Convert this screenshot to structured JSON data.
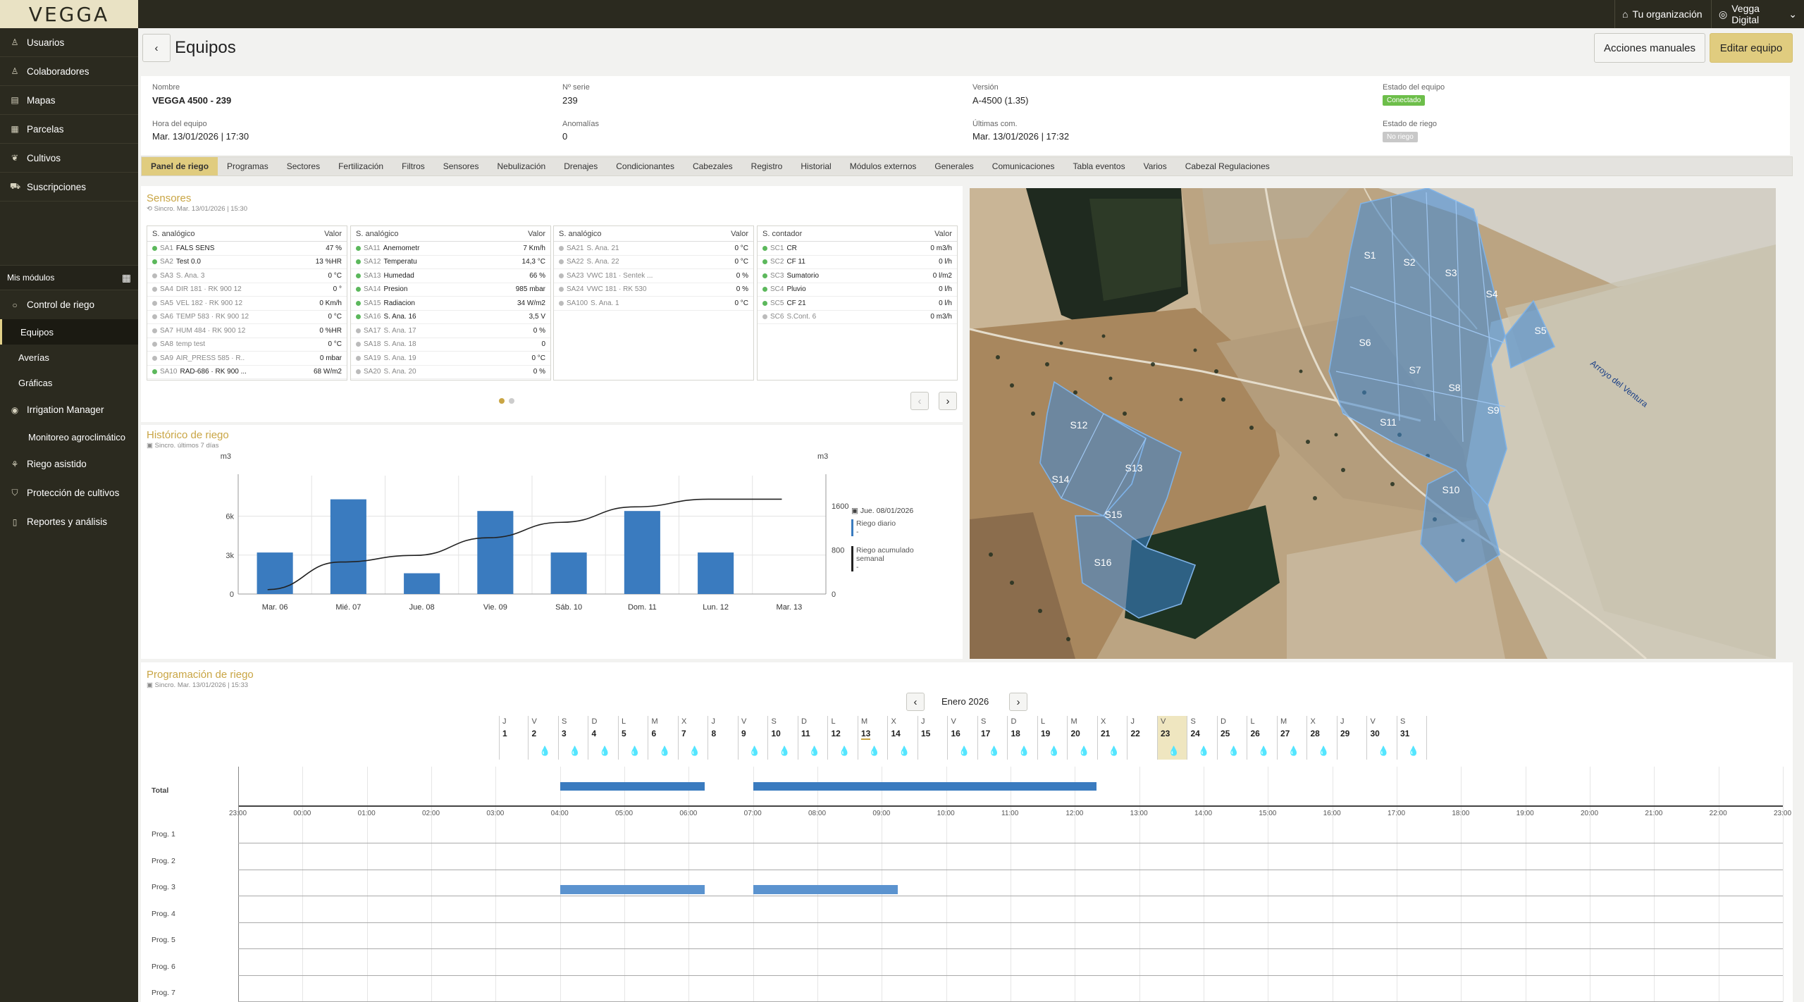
{
  "app": {
    "logo": "VEGGA"
  },
  "topbar": {
    "org_label": "Tu organización",
    "user_label": "Vegga Digital"
  },
  "sidebar": {
    "items": [
      {
        "label": "Usuarios",
        "icon": "user-icon"
      },
      {
        "label": "Colaboradores",
        "icon": "users-icon"
      },
      {
        "label": "Mapas",
        "icon": "map-icon"
      },
      {
        "label": "Parcelas",
        "icon": "plot-icon"
      },
      {
        "label": "Cultivos",
        "icon": "leaf-icon"
      },
      {
        "label": "Suscripciones",
        "icon": "cart-icon"
      }
    ],
    "modules_label": "Mis módulos",
    "modules": [
      {
        "label": "Control de riego"
      },
      {
        "label": "Equipos"
      },
      {
        "label": "Averías"
      },
      {
        "label": "Gráficas"
      },
      {
        "label": "Irrigation Manager"
      },
      {
        "label": "Monitoreo agroclimático"
      },
      {
        "label": "Riego asistido"
      },
      {
        "label": "Protección de cultivos"
      },
      {
        "label": "Reportes y análisis"
      }
    ]
  },
  "header": {
    "title": "Equipos",
    "manual_actions": "Acciones manuales",
    "edit": "Editar equipo"
  },
  "info": {
    "nombre_label": "Nombre",
    "nombre": "VEGGA 4500 - 239",
    "serie_label": "Nº serie",
    "serie": "239",
    "version_label": "Versión",
    "version": "A-4500 (1.35)",
    "estado_label": "Estado del equipo",
    "estado": "Conectado",
    "hora_label": "Hora del equipo",
    "hora": "Mar. 13/01/2026 | 17:30",
    "anomalias_label": "Anomalías",
    "anomalias": "0",
    "ultimas_label": "Últimas com.",
    "ultimas": "Mar. 13/01/2026 | 17:32",
    "riego_label": "Estado de riego",
    "riego": "No riego"
  },
  "tabs": [
    "Panel de riego",
    "Programas",
    "Sectores",
    "Fertilización",
    "Filtros",
    "Sensores",
    "Nebulización",
    "Drenajes",
    "Condicionantes",
    "Cabezales",
    "Registro",
    "Historial",
    "Módulos externos",
    "Generales",
    "Comunicaciones",
    "Tabla eventos",
    "Varios",
    "Cabezal Regulaciones"
  ],
  "sensores": {
    "title": "Sensores",
    "sync": "Sincro. Mar. 13/01/2026 | 15:30",
    "tables": [
      {
        "header": "S. analógico",
        "value_header": "Valor",
        "rows": [
          {
            "code": "SA1",
            "name": "FALS SENS",
            "value": "47 %",
            "on": true
          },
          {
            "code": "SA2",
            "name": "Test 0.0",
            "value": "13 %HR",
            "on": true
          },
          {
            "code": "SA3",
            "name": "S. Ana. 3",
            "value": "0 °C",
            "on": false
          },
          {
            "code": "SA4",
            "name": "DIR 181 · RK 900 12",
            "value": "0 °",
            "on": false
          },
          {
            "code": "SA5",
            "name": "VEL 182 · RK 900 12",
            "value": "0 Km/h",
            "on": false
          },
          {
            "code": "SA6",
            "name": "TEMP 583 · RK 900 12",
            "value": "0 °C",
            "on": false
          },
          {
            "code": "SA7",
            "name": "HUM 484 · RK 900 12",
            "value": "0 %HR",
            "on": false
          },
          {
            "code": "SA8",
            "name": "temp test",
            "value": "0 °C",
            "on": false
          },
          {
            "code": "SA9",
            "name": "AIR_PRESS 585 · R..",
            "value": "0 mbar",
            "on": false
          },
          {
            "code": "SA10",
            "name": "RAD-686 · RK 900 ...",
            "value": "68 W/m2",
            "on": true
          }
        ]
      },
      {
        "header": "S. analógico",
        "value_header": "Valor",
        "rows": [
          {
            "code": "SA11",
            "name": "Anemometr",
            "value": "7 Km/h",
            "on": true
          },
          {
            "code": "SA12",
            "name": "Temperatu",
            "value": "14,3 °C",
            "on": true
          },
          {
            "code": "SA13",
            "name": "Humedad",
            "value": "66 %",
            "on": true
          },
          {
            "code": "SA14",
            "name": "Presion",
            "value": "985 mbar",
            "on": true
          },
          {
            "code": "SA15",
            "name": "Radiacion",
            "value": "34 W/m2",
            "on": true
          },
          {
            "code": "SA16",
            "name": "S. Ana. 16",
            "value": "3,5 V",
            "on": true
          },
          {
            "code": "SA17",
            "name": "S. Ana. 17",
            "value": "0 %",
            "on": false
          },
          {
            "code": "SA18",
            "name": "S. Ana. 18",
            "value": "0",
            "on": false
          },
          {
            "code": "SA19",
            "name": "S. Ana. 19",
            "value": "0 °C",
            "on": false
          },
          {
            "code": "SA20",
            "name": "S. Ana. 20",
            "value": "0 %",
            "on": false
          }
        ]
      },
      {
        "header": "S. analógico",
        "value_header": "Valor",
        "rows": [
          {
            "code": "SA21",
            "name": "S. Ana. 21",
            "value": "0 °C",
            "on": false
          },
          {
            "code": "SA22",
            "name": "S. Ana. 22",
            "value": "0 °C",
            "on": false
          },
          {
            "code": "SA23",
            "name": "VWC 181 · Sentek ...",
            "value": "0 %",
            "on": false
          },
          {
            "code": "SA24",
            "name": "VWC 181 · RK 530",
            "value": "0 %",
            "on": false
          },
          {
            "code": "SA100",
            "name": "S. Ana. 1",
            "value": "0 °C",
            "on": false
          }
        ]
      },
      {
        "header": "S. contador",
        "value_header": "Valor",
        "rows": [
          {
            "code": "SC1",
            "name": "CR",
            "value": "0 m3/h",
            "on": true
          },
          {
            "code": "SC2",
            "name": "CF 11",
            "value": "0 l/h",
            "on": true
          },
          {
            "code": "SC3",
            "name": "Sumatorio",
            "value": "0 l/m2",
            "on": true
          },
          {
            "code": "SC4",
            "name": "Pluvio",
            "value": "0 l/h",
            "on": true
          },
          {
            "code": "SC5",
            "name": "CF 21",
            "value": "0 l/h",
            "on": true
          },
          {
            "code": "SC6",
            "name": "S.Cont. 6",
            "value": "0 m3/h",
            "on": false
          }
        ]
      }
    ]
  },
  "historico": {
    "title": "Histórico de riego",
    "sync": "Sincro. últimos 7 días",
    "legend_date": "Jue. 08/01/2026",
    "legend_daily": "Riego diario",
    "legend_daily_value": "-",
    "legend_weekly": "Riego acumulado semanal",
    "legend_weekly_value": "-"
  },
  "chart_data": {
    "type": "bar",
    "categories": [
      "Mar. 06",
      "Mié. 07",
      "Jue. 08",
      "Vie. 09",
      "Sáb. 10",
      "Dom. 11",
      "Lun. 12",
      "Mar. 13"
    ],
    "series": [
      {
        "name": "Riego diario",
        "type": "bar",
        "axis": "left",
        "values": [
          3200,
          7300,
          1600,
          6400,
          3200,
          6400,
          3200,
          0
        ]
      },
      {
        "name": "Riego acumulado semanal",
        "type": "line",
        "axis": "right",
        "values": [
          80,
          580,
          700,
          1020,
          1300,
          1580,
          1720,
          1720
        ]
      }
    ],
    "ylabel": "m3",
    "y2label": "m3",
    "ylim": [
      0,
      8800
    ],
    "yticks": [
      0,
      3000,
      6000
    ],
    "ytick_labels": [
      "0",
      "3k",
      "6k"
    ],
    "y2lim": [
      0,
      2070
    ],
    "y2ticks": [
      0,
      800,
      1600
    ],
    "grid": true
  },
  "map": {
    "sectors": [
      "S1",
      "S2",
      "S3",
      "S4",
      "S5",
      "S6",
      "S7",
      "S8",
      "S9",
      "S10",
      "S11",
      "S12",
      "S13",
      "S14",
      "S15",
      "S16"
    ],
    "road_label": "Arroyo del Ventura"
  },
  "programacion": {
    "title": "Programación de riego",
    "sync": "Sincro. Mar. 13/01/2026 | 15:33",
    "month": "Enero 2026",
    "weekdays": [
      "J",
      "V",
      "S",
      "D",
      "L",
      "M",
      "X",
      "J",
      "V",
      "S",
      "D",
      "L",
      "M",
      "X",
      "J",
      "V",
      "S",
      "D",
      "L",
      "M",
      "X",
      "J",
      "V",
      "S",
      "D",
      "L",
      "M",
      "X",
      "J",
      "V",
      "S"
    ],
    "days": [
      "1",
      "2",
      "3",
      "4",
      "5",
      "6",
      "7",
      "8",
      "9",
      "10",
      "11",
      "12",
      "13",
      "14",
      "15",
      "16",
      "17",
      "18",
      "19",
      "20",
      "21",
      "22",
      "23",
      "24",
      "25",
      "26",
      "27",
      "28",
      "29",
      "30",
      "31"
    ],
    "drops": [
      false,
      true,
      true,
      true,
      true,
      true,
      true,
      false,
      true,
      true,
      true,
      true,
      true,
      true,
      false,
      true,
      true,
      true,
      true,
      true,
      true,
      false,
      true,
      true,
      true,
      true,
      true,
      true,
      false,
      true,
      true
    ],
    "hours": [
      "23:00",
      "00:00",
      "01:00",
      "02:00",
      "03:00",
      "04:00",
      "05:00",
      "06:00",
      "07:00",
      "08:00",
      "09:00",
      "10:00",
      "11:00",
      "12:00",
      "13:00",
      "14:00",
      "15:00",
      "16:00",
      "17:00",
      "18:00",
      "19:00",
      "20:00",
      "21:00",
      "22:00",
      "23:00"
    ],
    "total_label": "Total",
    "programs": [
      "Prog. 1",
      "Prog. 2",
      "Prog. 3",
      "Prog. 4",
      "Prog. 5",
      "Prog. 6",
      "Prog. 7"
    ],
    "total_bars": [
      {
        "start": "04:00",
        "end": "06:15"
      },
      {
        "start": "07:00",
        "end": "12:20"
      }
    ],
    "prog3_bars": [
      {
        "start": "04:00",
        "end": "06:15"
      },
      {
        "start": "07:00",
        "end": "09:15"
      }
    ]
  }
}
